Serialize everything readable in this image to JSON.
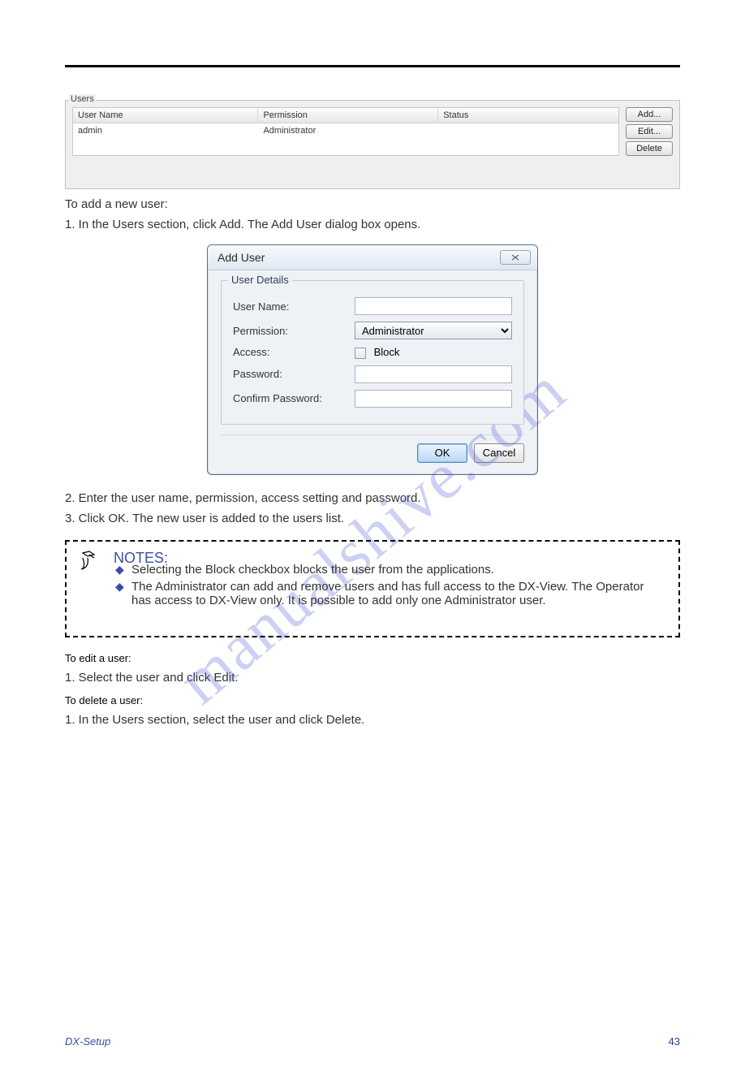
{
  "users_panel": {
    "legend": "Users",
    "columns": [
      "User Name",
      "Permission",
      "Status"
    ],
    "rows": [
      {
        "user": "admin",
        "perm": "Administrator",
        "status": ""
      }
    ],
    "buttons": {
      "add": "Add...",
      "edit": "Edit...",
      "del": "Delete"
    }
  },
  "para1": "To add a new user:",
  "step1": "1.  In the Users section, click Add. The Add User dialog box opens.",
  "dialog": {
    "title": "Add User",
    "legend": "User Details",
    "labels": {
      "user": "User Name:",
      "perm": "Permission:",
      "access": "Access:",
      "block": "Block",
      "pass": "Password:",
      "cpass": "Confirm Password:"
    },
    "perm_value": "Administrator",
    "ok": "OK",
    "cancel": "Cancel"
  },
  "step2_a": "2.  Enter the user name, permission, access setting and password.",
  "step2_b": "3.  Click OK. The new user is added to the users list.",
  "note": {
    "title": "NOTES:",
    "items": [
      "Selecting the Block checkbox blocks the user from the applications.",
      "The Administrator can add and remove users and has full access to the DX-View. The Operator has access to DX-View only. It is possible to add only one Administrator user."
    ]
  },
  "edit_intro": "To edit a user:",
  "edit_step": "1.  Select the user and click Edit.",
  "del_intro": "To delete a user:",
  "del_step": "1.  In the Users section, select the user and click Delete.",
  "footer": {
    "left": "DX-Setup",
    "right": "43"
  },
  "watermark": "manualshive.com"
}
